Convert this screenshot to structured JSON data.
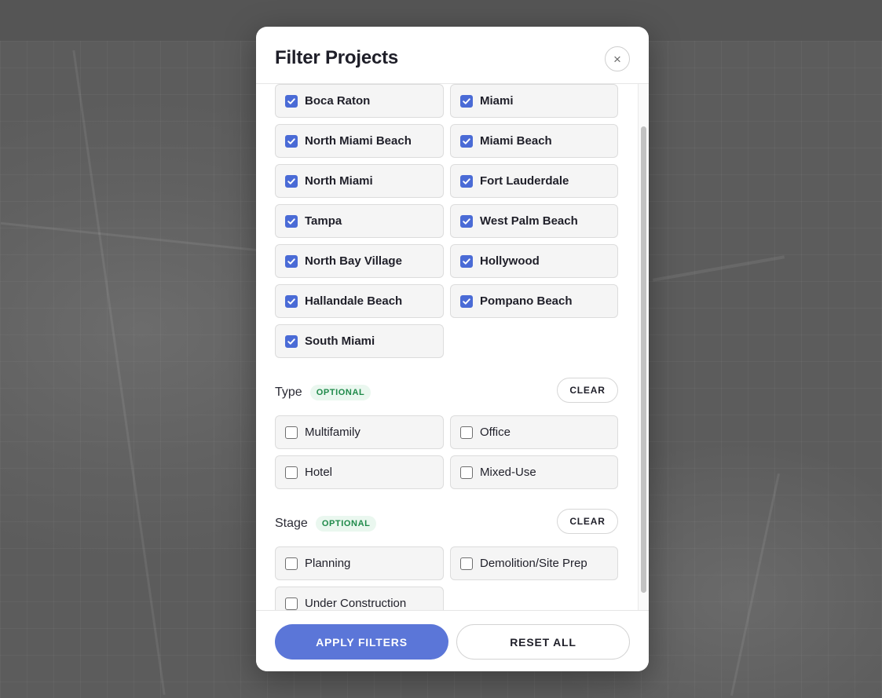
{
  "modal": {
    "title": "Filter Projects",
    "close_icon": "×"
  },
  "locations": {
    "items": [
      {
        "label": "Boca Raton",
        "checked": true
      },
      {
        "label": "Miami",
        "checked": true
      },
      {
        "label": "North Miami Beach",
        "checked": true
      },
      {
        "label": "Miami Beach",
        "checked": true
      },
      {
        "label": "North Miami",
        "checked": true
      },
      {
        "label": "Fort Lauderdale",
        "checked": true
      },
      {
        "label": "Tampa",
        "checked": true
      },
      {
        "label": "West Palm Beach",
        "checked": true
      },
      {
        "label": "North Bay Village",
        "checked": true
      },
      {
        "label": "Hollywood",
        "checked": true
      },
      {
        "label": "Hallandale Beach",
        "checked": true
      },
      {
        "label": "Pompano Beach",
        "checked": true
      },
      {
        "label": "South Miami",
        "checked": true
      }
    ]
  },
  "type_section": {
    "title": "Type",
    "badge": "OPTIONAL",
    "clear_label": "CLEAR",
    "items": [
      {
        "label": "Multifamily",
        "checked": false
      },
      {
        "label": "Office",
        "checked": false
      },
      {
        "label": "Hotel",
        "checked": false
      },
      {
        "label": "Mixed-Use",
        "checked": false
      }
    ]
  },
  "stage_section": {
    "title": "Stage",
    "badge": "OPTIONAL",
    "clear_label": "CLEAR",
    "items": [
      {
        "label": "Planning",
        "checked": false
      },
      {
        "label": "Demolition/Site Prep",
        "checked": false
      },
      {
        "label": "Under Construction",
        "checked": false
      }
    ]
  },
  "footer": {
    "apply_label": "APPLY FILTERS",
    "reset_label": "RESET ALL"
  },
  "colors": {
    "accent": "#5b76d8",
    "checkbox_checked": "#4a6bd6",
    "badge_text": "#1f8a4a",
    "badge_bg": "#eaf7ef"
  },
  "icons": {
    "close": "close-icon",
    "check": "checkmark-icon"
  }
}
